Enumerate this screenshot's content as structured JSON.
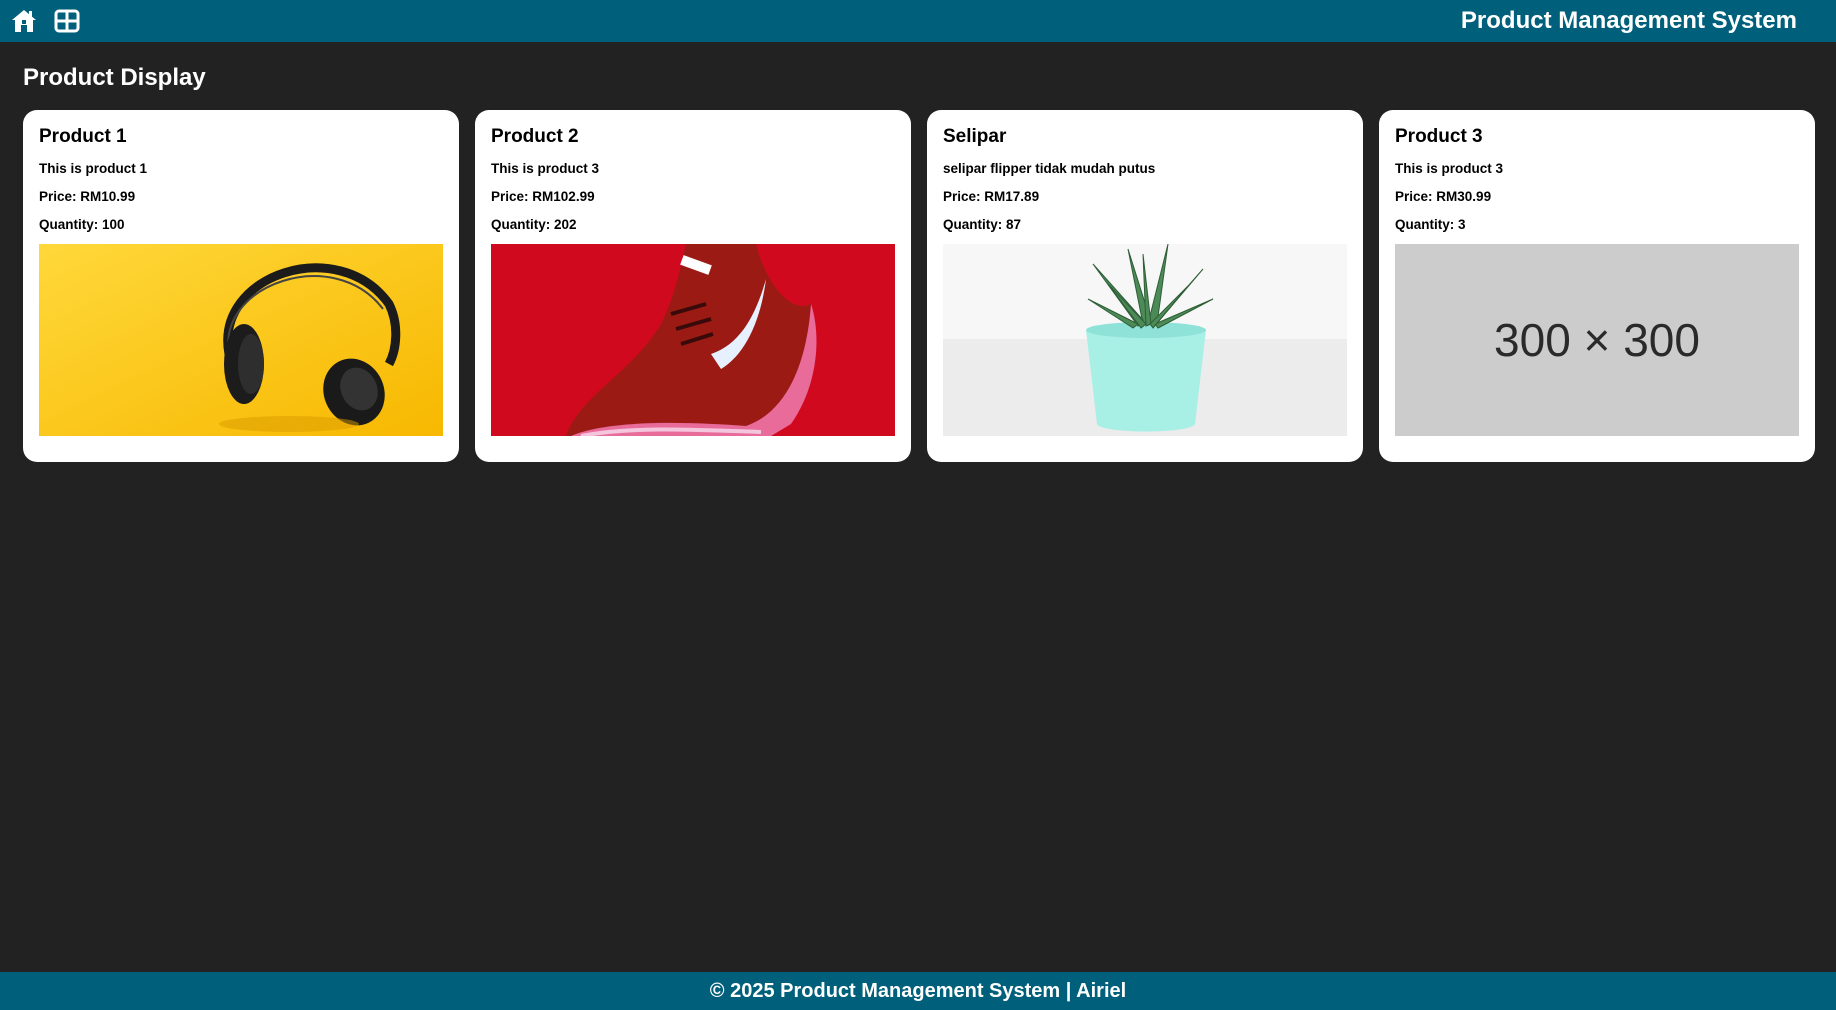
{
  "header": {
    "title": "Product Management System",
    "icons": [
      "home-icon",
      "grid-icon"
    ]
  },
  "page": {
    "title": "Product Display"
  },
  "products": [
    {
      "name": "Product 1",
      "description": "This is product 1",
      "price_label": "Price:",
      "price": "RM10.99",
      "quantity_label": "Quantity:",
      "quantity": "100"
    },
    {
      "name": "Product 2",
      "description": "This is product 3",
      "price_label": "Price:",
      "price": "RM102.99",
      "quantity_label": "Quantity:",
      "quantity": "202"
    },
    {
      "name": "Selipar",
      "description": "selipar flipper tidak mudah putus",
      "price_label": "Price:",
      "price": "RM17.89",
      "quantity_label": "Quantity:",
      "quantity": "87"
    },
    {
      "name": "Product 3",
      "description": "This is product 3",
      "price_label": "Price:",
      "price": "RM30.99",
      "quantity_label": "Quantity:",
      "quantity": "3",
      "placeholder_text": "300 × 300"
    }
  ],
  "footer": {
    "text": "© 2025 Product Management System | Airiel"
  },
  "colors": {
    "header_bg": "#005f7a",
    "page_bg": "#222222",
    "card_bg": "#ffffff",
    "placeholder_bg": "#cccccc"
  }
}
